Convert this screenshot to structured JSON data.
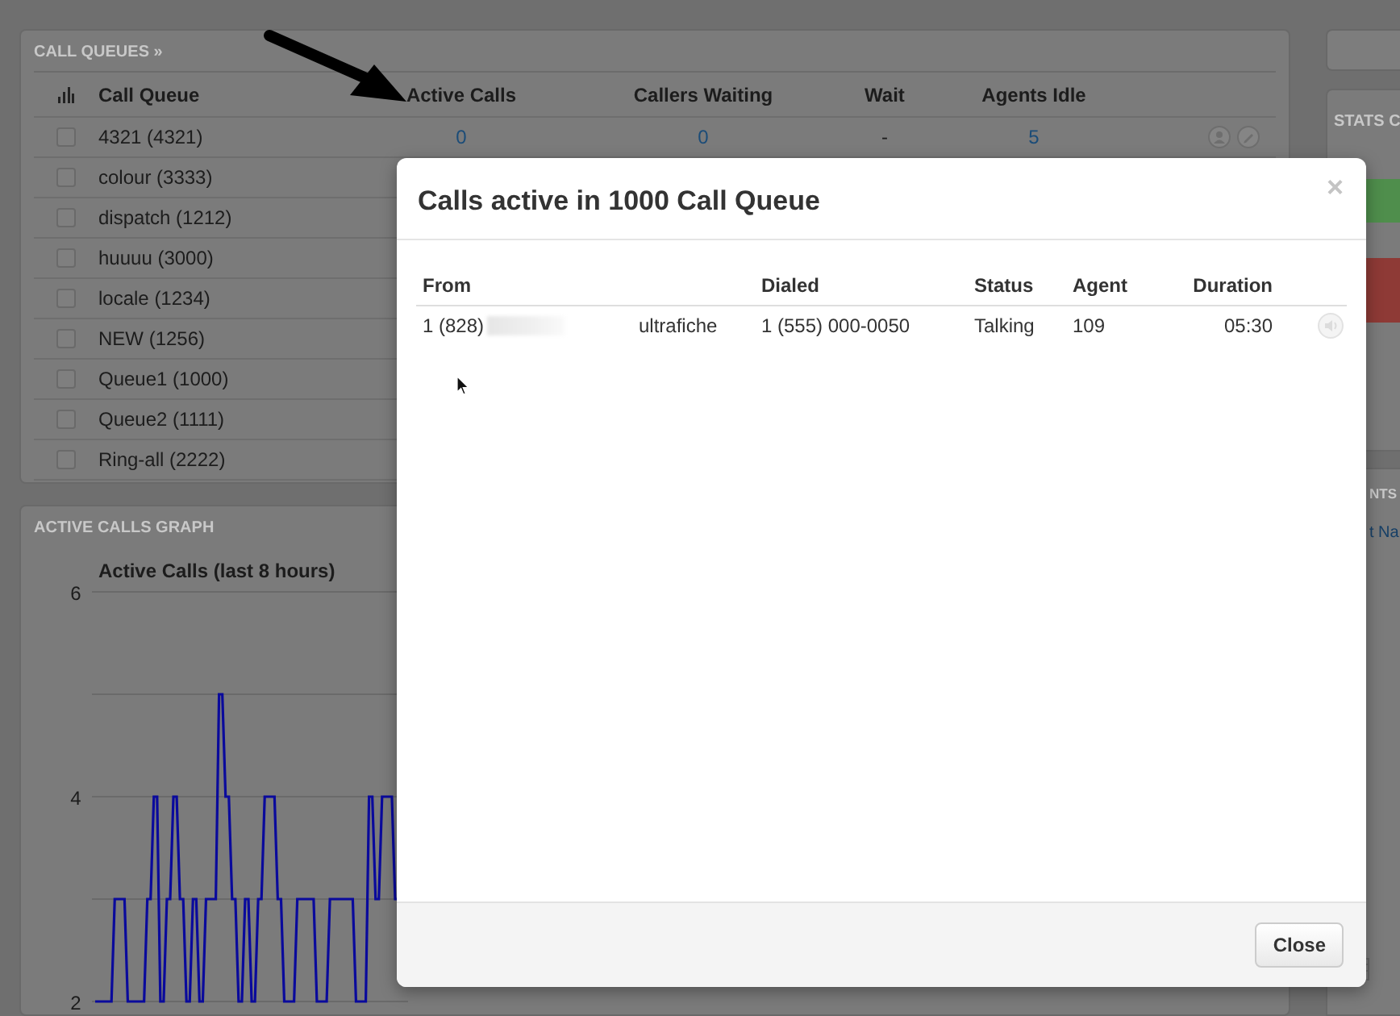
{
  "call_queues": {
    "title": "CALL QUEUES »",
    "columns": [
      "Call Queue",
      "Active Calls",
      "Callers Waiting",
      "Wait",
      "Agents Idle"
    ],
    "rows": [
      {
        "checked": false,
        "cells": [
          "4321 (4321)",
          "0",
          "0",
          "-",
          "5"
        ],
        "actions": true
      },
      {
        "checked": false,
        "cells": [
          "colour (3333)"
        ]
      },
      {
        "checked": false,
        "cells": [
          "dispatch (1212)"
        ]
      },
      {
        "checked": false,
        "cells": [
          "huuuu (3000)"
        ]
      },
      {
        "checked": false,
        "cells": [
          "locale (1234)"
        ]
      },
      {
        "checked": false,
        "cells": [
          "NEW (1256)"
        ]
      },
      {
        "checked": false,
        "cells": [
          "Queue1 (1000)"
        ]
      },
      {
        "checked": false,
        "cells": [
          "Queue2 (1111)"
        ]
      },
      {
        "checked": false,
        "cells": [
          "Ring-all (2222)"
        ]
      }
    ]
  },
  "graph_panel": {
    "title": "ACTIVE CALLS GRAPH",
    "chart_data": {
      "type": "line",
      "title": "Active Calls (last 8 hours)",
      "categories": [
        null,
        null,
        null,
        null,
        null,
        null,
        null,
        null,
        null,
        null,
        null,
        null,
        null,
        null,
        null,
        null,
        null,
        null,
        null,
        null,
        null,
        null,
        null,
        null,
        null,
        null,
        null,
        null,
        null,
        null,
        null,
        null,
        null,
        null,
        null,
        null,
        null,
        null,
        null,
        null,
        null,
        null,
        null,
        null,
        null,
        null,
        null,
        null,
        null,
        null,
        null,
        null,
        null,
        null,
        null,
        null,
        null,
        null,
        null,
        null,
        null,
        null,
        null,
        null,
        null,
        null,
        null,
        null,
        null,
        null,
        null,
        null,
        null,
        null,
        null,
        null,
        null,
        null,
        null,
        null,
        null,
        null,
        null,
        null,
        null,
        null,
        null,
        null,
        null,
        null,
        null,
        null,
        null,
        null
      ],
      "ylim": [
        2,
        6
      ],
      "yticks": [
        2,
        4,
        6
      ],
      "series": [
        {
          "color": "#0a0a9c",
          "values": [
            2,
            2,
            2,
            2,
            2,
            2,
            3,
            3,
            3,
            3,
            2,
            2,
            2,
            2,
            2,
            2,
            3,
            3,
            4,
            4,
            2,
            2,
            3,
            3,
            4,
            4,
            3,
            3,
            2,
            2,
            3,
            3,
            2,
            2,
            3,
            3,
            3,
            3,
            5,
            5,
            4,
            4,
            3,
            3,
            2,
            2,
            3,
            3,
            2,
            2,
            3,
            3,
            4,
            4,
            4,
            4,
            3,
            3,
            2,
            2,
            2,
            2,
            3,
            3,
            3,
            3,
            3,
            3,
            2,
            2,
            2,
            2,
            3,
            3,
            3,
            3,
            3,
            3,
            3,
            3,
            2,
            2,
            2,
            2,
            4,
            4,
            3,
            3,
            4,
            4,
            4,
            4,
            3,
            3
          ]
        }
      ]
    }
  },
  "stats_panel": {
    "title": "STATS C"
  },
  "lower_panel": {
    "title": "NTS",
    "link": "t Na"
  },
  "modal": {
    "title": "Calls active in 1000 Call Queue",
    "close_glyph": "×",
    "columns": [
      "From",
      "",
      "Dialed",
      "Status",
      "Agent",
      "Duration"
    ],
    "rows": [
      {
        "cells": [
          "1 (828)",
          "ultrafiche",
          "1 (555) 000-0050",
          "Talking",
          "109",
          "05:30"
        ],
        "redacted": true
      }
    ],
    "footer_button": "Close"
  }
}
